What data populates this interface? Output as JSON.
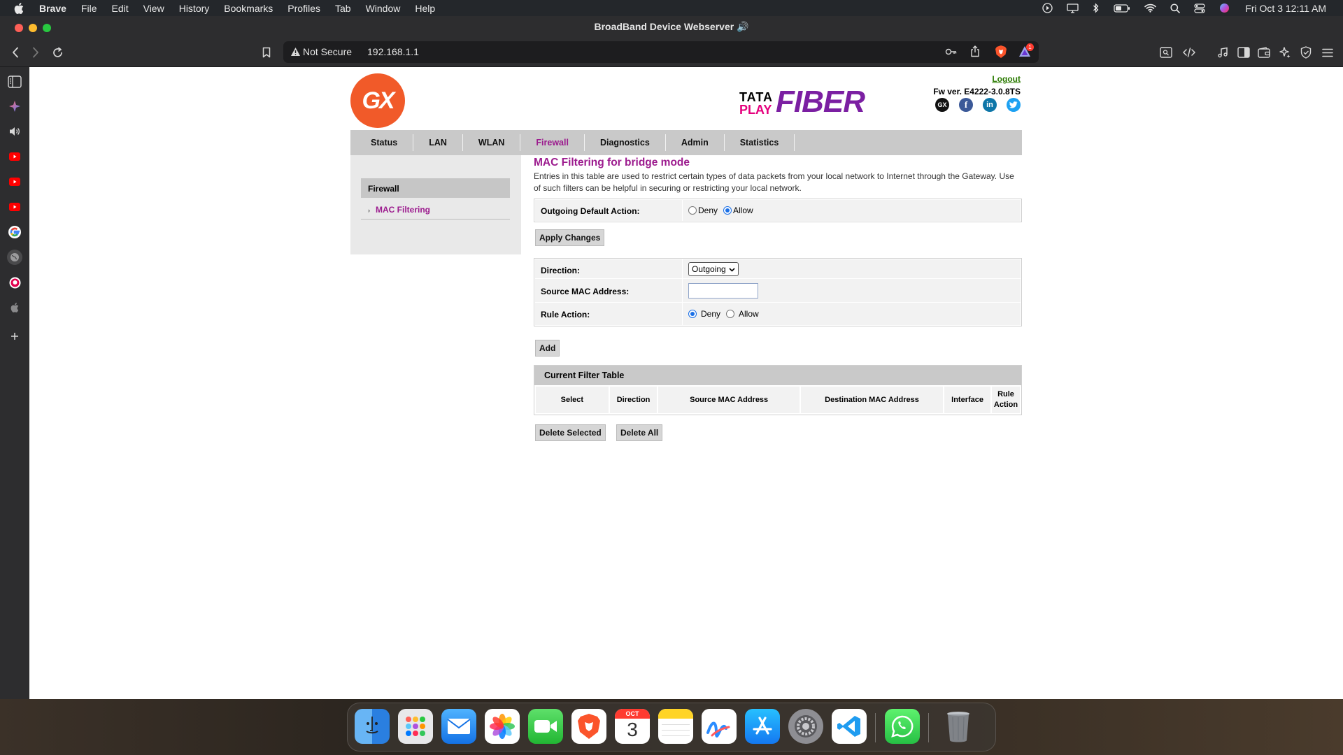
{
  "menubar": {
    "app": "Brave",
    "items": [
      "File",
      "Edit",
      "View",
      "History",
      "Bookmarks",
      "Profiles",
      "Tab",
      "Window",
      "Help"
    ],
    "clock": "Fri Oct 3  12:11 AM"
  },
  "window": {
    "title": "BroadBand Device Webserver 🔊"
  },
  "urlbar": {
    "security": "Not Secure",
    "url": "192.168.1.1",
    "shields_badge": "1"
  },
  "header": {
    "logo_text": "GX",
    "brand_tata": "TATA",
    "brand_play": "PLAY",
    "brand_fiber": "FIBER",
    "logout": "Logout",
    "fw_version": "Fw ver. E4222-3.0.8TS",
    "social_gx": "GX",
    "social_fb": "f",
    "social_in": "in"
  },
  "nav": {
    "tabs": [
      {
        "label": "Status"
      },
      {
        "label": "LAN"
      },
      {
        "label": "WLAN"
      },
      {
        "label": "Firewall"
      },
      {
        "label": "Diagnostics"
      },
      {
        "label": "Admin"
      },
      {
        "label": "Statistics"
      }
    ],
    "active": "Firewall"
  },
  "leftpanel": {
    "header": "Firewall",
    "items": [
      {
        "label": "MAC Filtering"
      }
    ]
  },
  "main": {
    "title": "MAC Filtering for bridge mode",
    "description": "Entries in this table are used to restrict certain types of data packets from your local network to Internet through the Gateway. Use of such filters can be helpful in securing or restricting your local network.",
    "outgoing_label": "Outgoing Default Action:",
    "deny": "Deny",
    "allow": "Allow",
    "outgoing_selected": "Allow",
    "apply_button": "Apply Changes",
    "direction_label": "Direction:",
    "direction_value": "Outgoing",
    "source_mac_label": "Source MAC Address:",
    "source_mac_value": "",
    "rule_action_label": "Rule Action:",
    "rule_action_selected": "Deny",
    "add_button": "Add",
    "table_title": "Current Filter Table",
    "table_columns": [
      "Select",
      "Direction",
      "Source MAC Address",
      "Destination MAC Address",
      "Interface",
      "Rule Action"
    ],
    "delete_selected": "Delete Selected",
    "delete_all": "Delete All"
  },
  "dock": {
    "calendar_month": "OCT",
    "calendar_day": "3"
  },
  "colors": {
    "accent": "#9c1b8e",
    "gx_orange": "#f15a29",
    "fiber_purple": "#7b1fa2",
    "nav_gray": "#c9c9c9"
  },
  "icons": {
    "sidebar": [
      "sidebar-toggle-icon",
      "leo-ai-icon",
      "speaker-icon",
      "youtube-icon",
      "youtube-icon",
      "youtube-icon",
      "google-icon",
      "globe-icon",
      "brave-talk-icon",
      "apple-icon",
      "add-icon"
    ],
    "dock": [
      "finder-icon",
      "launchpad-icon",
      "mail-icon",
      "photos-icon",
      "facetime-icon",
      "brave-icon",
      "calendar-icon",
      "notes-icon",
      "freeform-icon",
      "app-store-icon",
      "system-settings-icon",
      "vscode-icon",
      "whatsapp-icon",
      "trash-icon"
    ]
  }
}
